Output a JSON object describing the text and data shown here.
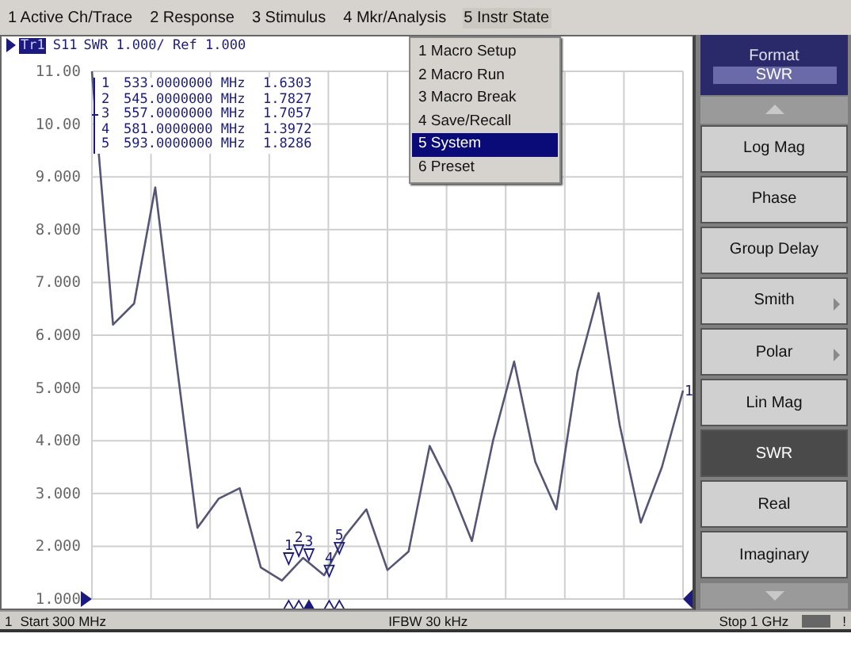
{
  "menu_bar": [
    {
      "label": "1 Active Ch/Trace",
      "selected": false
    },
    {
      "label": "2 Response",
      "selected": false
    },
    {
      "label": "3 Stimulus",
      "selected": false
    },
    {
      "label": "4 Mkr/Analysis",
      "selected": false
    },
    {
      "label": "5 Instr State",
      "selected": true
    }
  ],
  "dropdown_menu": [
    {
      "label": "1 Macro Setup",
      "selected": false
    },
    {
      "label": "2 Macro Run",
      "selected": false
    },
    {
      "label": "3 Macro Break",
      "selected": false
    },
    {
      "label": "4 Save/Recall",
      "selected": false
    },
    {
      "label": "5 System",
      "selected": true
    },
    {
      "label": "6 Preset",
      "selected": false
    }
  ],
  "trace_header": {
    "trace": "Tr1",
    "format_scale": "SWR 1.000/ Ref 1.000"
  },
  "marker_readout": [
    {
      "number": "1",
      "frequency": "533.0000000 MHz",
      "value": "1.6303",
      "selected": false
    },
    {
      "number": "2",
      "frequency": "545.0000000 MHz",
      "value": "1.7827",
      "selected": false
    },
    {
      "number": "3",
      "frequency": "557.0000000 MHz",
      "value": "1.7057",
      "selected": true
    },
    {
      "number": "4",
      "frequency": "581.0000000 MHz",
      "value": "1.3972",
      "selected": false
    },
    {
      "number": "5",
      "frequency": "593.0000000 MHz",
      "value": "1.8286",
      "selected": false
    }
  ],
  "trace_end_label": "1",
  "trace_markers": [
    {
      "label": "1"
    },
    {
      "label": "2"
    },
    {
      "label": "3"
    },
    {
      "label": "4"
    },
    {
      "label": "5"
    }
  ],
  "chart_data": {
    "type": "line",
    "categories": [
      null,
      null,
      null,
      null,
      null,
      null,
      null,
      null,
      null,
      null,
      null,
      null,
      null,
      null,
      null,
      null,
      null,
      null,
      null,
      null,
      null,
      null,
      null,
      null,
      null,
      null,
      null,
      null,
      null
    ],
    "series": [
      {
        "name": "S11",
        "color": "#555577",
        "values": [
          11.0,
          6.2,
          6.6,
          8.8,
          5.5,
          2.35,
          2.9,
          3.1,
          1.6,
          1.35,
          1.78,
          1.45,
          2.2,
          2.7,
          1.55,
          1.9,
          3.9,
          3.1,
          2.1,
          4.0,
          5.5,
          3.6,
          2.7,
          5.3,
          6.8,
          4.3,
          2.45,
          3.5,
          4.95
        ]
      }
    ],
    "ylim": [
      1,
      11
    ],
    "grid": true,
    "yticks": [
      {
        "value": 1,
        "label": "1.000"
      },
      {
        "value": 2,
        "label": "2.000"
      },
      {
        "value": 3,
        "label": "3.000"
      },
      {
        "value": 4,
        "label": "4.000"
      },
      {
        "value": 5,
        "label": "5.000"
      },
      {
        "value": 6,
        "label": "6.000"
      },
      {
        "value": 7,
        "label": "7.000"
      },
      {
        "value": 8,
        "label": "8.000"
      },
      {
        "value": 9,
        "label": "9.000"
      },
      {
        "value": 10,
        "label": "10.00"
      },
      {
        "value": 11,
        "label": "11.00"
      }
    ]
  },
  "status_bar": {
    "channel": "1",
    "start": "Start 300 MHz",
    "ifbw": "IFBW 30 kHz",
    "stop": "Stop 1 GHz",
    "indicator": "!"
  },
  "softkeys": {
    "title": "Format",
    "value": "SWR",
    "items": [
      {
        "label": "Log Mag",
        "selected": false,
        "submenu": false
      },
      {
        "label": "Phase",
        "selected": false,
        "submenu": false
      },
      {
        "label": "Group Delay",
        "selected": false,
        "submenu": false
      },
      {
        "label": "Smith",
        "selected": false,
        "submenu": true
      },
      {
        "label": "Polar",
        "selected": false,
        "submenu": true
      },
      {
        "label": "Lin Mag",
        "selected": false,
        "submenu": false
      },
      {
        "label": "SWR",
        "selected": true,
        "submenu": false
      },
      {
        "label": "Real",
        "selected": false,
        "submenu": false
      },
      {
        "label": "Imaginary",
        "selected": false,
        "submenu": false
      }
    ]
  }
}
